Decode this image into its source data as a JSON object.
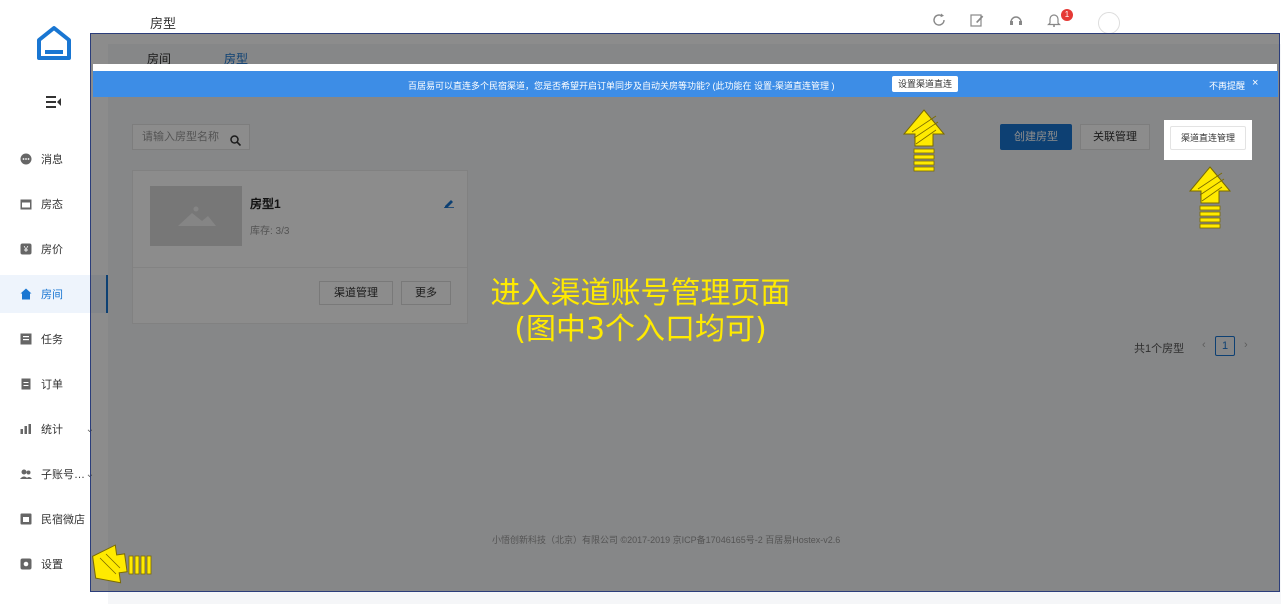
{
  "sidebar": {
    "items": [
      {
        "label": "消息",
        "icon": "message-icon"
      },
      {
        "label": "房态",
        "icon": "calendar-icon"
      },
      {
        "label": "房价",
        "icon": "price-icon"
      },
      {
        "label": "房间",
        "icon": "home-icon"
      },
      {
        "label": "任务",
        "icon": "task-icon"
      },
      {
        "label": "订单",
        "icon": "order-icon"
      },
      {
        "label": "统计",
        "icon": "stats-icon"
      },
      {
        "label": "子账号…",
        "icon": "users-icon"
      },
      {
        "label": "民宿微店",
        "icon": "shop-icon"
      },
      {
        "label": "设置",
        "icon": "settings-icon"
      }
    ],
    "active": "房间"
  },
  "header": {
    "title": "房型",
    "badge_count": "1"
  },
  "tabs": {
    "rooms": "房间",
    "room_types": "房型"
  },
  "banner": {
    "message": "百居易可以直连多个民宿渠道，您是否希望开启订单同步及自动关房等功能? (此功能在 设置-渠道直连管理 )",
    "set_button": "设置渠道直连",
    "no_remind": "不再提醒",
    "close": "×"
  },
  "toolbar": {
    "search_placeholder": "请输入房型名称",
    "create": "创建房型",
    "related": "关联管理",
    "direct": "渠道直连管理"
  },
  "card": {
    "name": "房型1",
    "stock": "库存: 3/3",
    "channel_button": "渠道管理",
    "more_button": "更多"
  },
  "pagination": {
    "summary": "共1个房型",
    "current": "1"
  },
  "footer": "小悟创新科技（北京）有限公司 ©2017-2019   京ICP备17046165号-2   百居易Hostex-v2.6",
  "annotation": {
    "line1": "进入渠道账号管理页面",
    "line2": "(图中3个入口均可)"
  },
  "colors": {
    "accent": "#1976d2",
    "banner": "#3d8de6",
    "annotation": "#ffea00"
  }
}
